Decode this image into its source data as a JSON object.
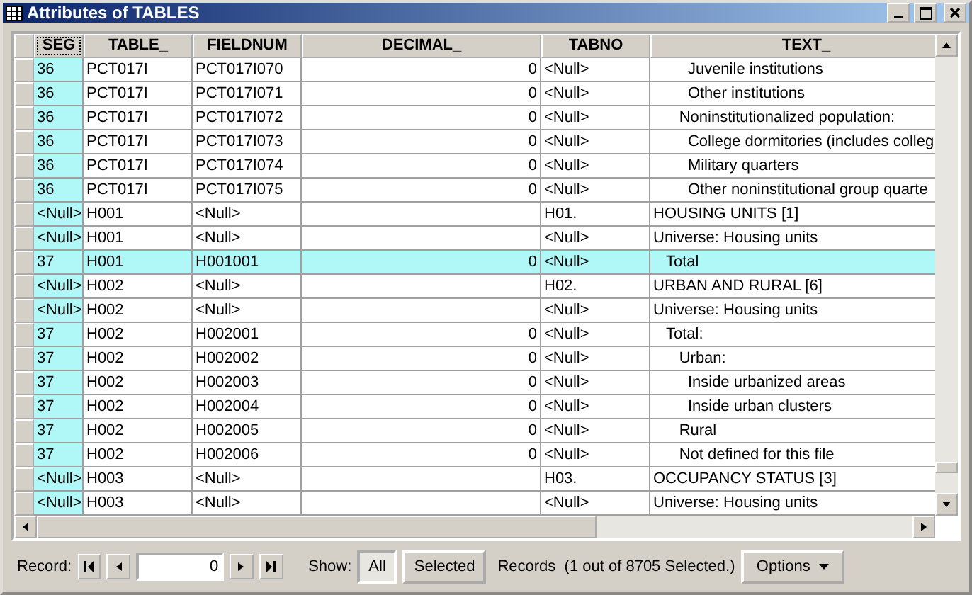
{
  "window": {
    "title": "Attributes of TABLES"
  },
  "table": {
    "columns": [
      {
        "label": "SEG",
        "active": true
      },
      {
        "label": "TABLE_",
        "active": false
      },
      {
        "label": "FIELDNUM",
        "active": false
      },
      {
        "label": "DECIMAL_",
        "active": false
      },
      {
        "label": "TABNO",
        "active": false
      },
      {
        "label": "TEXT_",
        "active": false
      }
    ],
    "rows": [
      {
        "seg": "36",
        "table": "PCT017I",
        "fieldnum": "PCT017I070",
        "decimal": "0",
        "tabno": "<Null>",
        "text": "        Juvenile institutions",
        "selected": false
      },
      {
        "seg": "36",
        "table": "PCT017I",
        "fieldnum": "PCT017I071",
        "decimal": "0",
        "tabno": "<Null>",
        "text": "        Other institutions",
        "selected": false
      },
      {
        "seg": "36",
        "table": "PCT017I",
        "fieldnum": "PCT017I072",
        "decimal": "0",
        "tabno": "<Null>",
        "text": "      Noninstitutionalized population:",
        "selected": false
      },
      {
        "seg": "36",
        "table": "PCT017I",
        "fieldnum": "PCT017I073",
        "decimal": "0",
        "tabno": "<Null>",
        "text": "        College dormitories (includes colleg",
        "selected": false
      },
      {
        "seg": "36",
        "table": "PCT017I",
        "fieldnum": "PCT017I074",
        "decimal": "0",
        "tabno": "<Null>",
        "text": "        Military quarters",
        "selected": false
      },
      {
        "seg": "36",
        "table": "PCT017I",
        "fieldnum": "PCT017I075",
        "decimal": "0",
        "tabno": "<Null>",
        "text": "        Other noninstitutional group quarte",
        "selected": false
      },
      {
        "seg": "<Null>",
        "table": "H001",
        "fieldnum": "<Null>",
        "tabno": "H01.",
        "text": "HOUSING UNITS [1]",
        "selected": false
      },
      {
        "seg": "<Null>",
        "table": "H001",
        "fieldnum": "<Null>",
        "tabno": "<Null>",
        "text": "Universe: Housing units",
        "selected": false
      },
      {
        "seg": "37",
        "table": "H001",
        "fieldnum": "H001001",
        "decimal": "0",
        "tabno": "<Null>",
        "text": "   Total",
        "selected": true
      },
      {
        "seg": "<Null>",
        "table": "H002",
        "fieldnum": "<Null>",
        "tabno": "H02.",
        "text": "URBAN AND RURAL [6]",
        "selected": false
      },
      {
        "seg": "<Null>",
        "table": "H002",
        "fieldnum": "<Null>",
        "tabno": "<Null>",
        "text": "Universe: Housing units",
        "selected": false
      },
      {
        "seg": "37",
        "table": "H002",
        "fieldnum": "H002001",
        "decimal": "0",
        "tabno": "<Null>",
        "text": "   Total:",
        "selected": false
      },
      {
        "seg": "37",
        "table": "H002",
        "fieldnum": "H002002",
        "decimal": "0",
        "tabno": "<Null>",
        "text": "      Urban:",
        "selected": false
      },
      {
        "seg": "37",
        "table": "H002",
        "fieldnum": "H002003",
        "decimal": "0",
        "tabno": "<Null>",
        "text": "        Inside urbanized areas",
        "selected": false
      },
      {
        "seg": "37",
        "table": "H002",
        "fieldnum": "H002004",
        "decimal": "0",
        "tabno": "<Null>",
        "text": "        Inside urban clusters",
        "selected": false
      },
      {
        "seg": "37",
        "table": "H002",
        "fieldnum": "H002005",
        "decimal": "0",
        "tabno": "<Null>",
        "text": "      Rural",
        "selected": false
      },
      {
        "seg": "37",
        "table": "H002",
        "fieldnum": "H002006",
        "decimal": "0",
        "tabno": "<Null>",
        "text": "      Not defined for this file",
        "selected": false
      },
      {
        "seg": "<Null>",
        "table": "H003",
        "fieldnum": "<Null>",
        "tabno": "H03.",
        "text": "OCCUPANCY STATUS [3]",
        "selected": false
      },
      {
        "seg": "<Null>",
        "table": "H003",
        "fieldnum": "<Null>",
        "tabno": "<Null>",
        "text": "Universe: Housing units",
        "selected": false
      }
    ]
  },
  "footer": {
    "record_label": "Record:",
    "record_value": "0",
    "show_label": "Show:",
    "show_options": [
      {
        "label": "All",
        "selected": true
      },
      {
        "label": "Selected",
        "selected": false
      }
    ],
    "records_text": "Records  (1 out of 8705 Selected.)",
    "options_button": "Options"
  }
}
